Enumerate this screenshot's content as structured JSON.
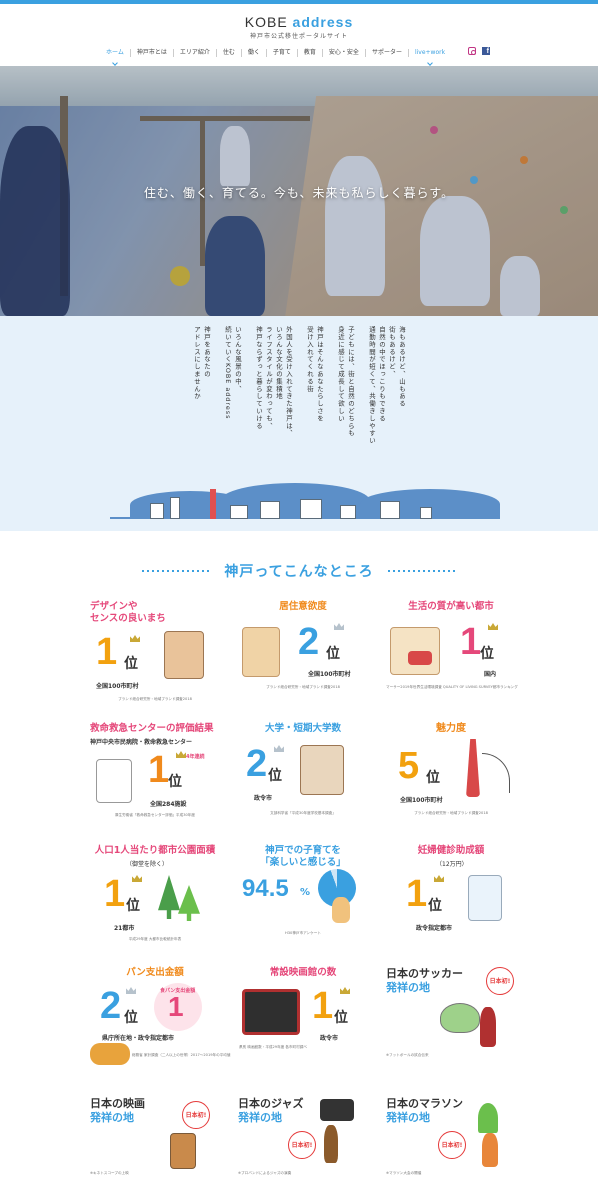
{
  "header": {
    "logo_main": "KOBE ",
    "logo_accent": "address",
    "logo_sub": "神戸市公式移住ポータルサイト"
  },
  "nav": [
    {
      "label": "ホーム"
    },
    {
      "label": "神戸市とは"
    },
    {
      "label": "エリア紹介"
    },
    {
      "label": "住む"
    },
    {
      "label": "働く"
    },
    {
      "label": "子育て"
    },
    {
      "label": "教育"
    },
    {
      "label": "安心・安全"
    },
    {
      "label": "サポーター"
    },
    {
      "label": "live+work"
    }
  ],
  "hero": {
    "catch": "住む、働く、育てる。今も、未来も私らしく暮らす。"
  },
  "intro": {
    "columns": [
      "海もあるけど、山もある",
      "街もあるけど、",
      "自然の中でほっこりもできる",
      "通勤時間が短くて、共働きしやすい",
      "",
      "子どもには、街と自然のどちらも",
      "身近に感じて成長して欲しい",
      "",
      "神戸はそんなあなたらしさを",
      "受け入れてくれる街",
      "",
      "外国人を受け入れてきた神戸は、",
      "いろんな文化の集積地",
      "ライフスタイルが変わっても、",
      "神戸ならずっと暮らしていける",
      "",
      "いろんな風景の中、",
      "続いていくKOBE address",
      "",
      "神戸をあなたの",
      "アドレスにしませんか"
    ]
  },
  "features": {
    "title": "神戸ってこんなところ",
    "cards": [
      {
        "title1": "デザインや",
        "title2": "センスの良いまち",
        "rank": "1",
        "unit": "位",
        "sub": "全国100市町村",
        "note": "ブランド総合研究所・地域ブランド調査2018"
      },
      {
        "title1": "居住意欲度",
        "title2": "",
        "rank": "2",
        "unit": "位",
        "sub": "全国100市町村",
        "note": "ブランド総合研究所・地域ブランド調査2018"
      },
      {
        "title1": "生活の質が高い都市",
        "title2": "",
        "rank": "1",
        "unit": "位",
        "sub": "国内",
        "note": "マーサー2019年世界生活環境調査 QUALITY OF LIVING SURVEY都市ランキング"
      },
      {
        "title1": "救命救急センターの評価結果",
        "title2": "神戸中央市民病院・救命救急センター",
        "rank": "1",
        "unit": "位",
        "sub": "全国284施設",
        "badge": "4年連続",
        "note": "厚生労働省「救命救急センター評価」平成30年度"
      },
      {
        "title1": "大学・短期大学数",
        "title2": "",
        "rank": "2",
        "unit": "位",
        "sub": "政令市",
        "note": "文部科学省「平成30年度学校基本調査」"
      },
      {
        "title1": "魅力度",
        "title2": "",
        "rank": "5",
        "unit": "位",
        "sub": "全国100市町村",
        "note": "ブランド総合研究所・地域ブランド調査2018"
      },
      {
        "title1": "人口1人当たり都市公園面積",
        "title2": "（御堂を除く）",
        "rank": "1",
        "unit": "位",
        "sub": "21都市",
        "note": "平成29年度 大都市比較統計年表"
      },
      {
        "title1": "神戸での子育てを",
        "title2": "「楽しいと感じる」",
        "rank": "94.5",
        "unit": "%",
        "sub": "",
        "note": "H30神戸市アンケート"
      },
      {
        "title1": "妊婦健診助成額",
        "title2": "（12万円）",
        "rank": "1",
        "unit": "位",
        "sub": "政令指定都市",
        "note": ""
      },
      {
        "title1": "パン支出金額",
        "title2": "食パン支出金額",
        "rank": "2",
        "rank2": "1",
        "unit": "位",
        "sub": "県庁所在地・政令指定都市",
        "note": "総務省 家計調査（二人以上の世帯）2017〜2019年の平均値"
      },
      {
        "title1": "常設映画館の数",
        "title2": "",
        "rank": "1",
        "unit": "位",
        "sub": "政令市",
        "note": "県別 映画館数・平成29年度 各市町村調べ"
      },
      {
        "title1": "日本のサッカー",
        "title2": "発祥の地",
        "rank": "",
        "unit": "",
        "sub": "",
        "badge": "日本初!",
        "note": "※フットボールの試合伝来"
      },
      {
        "title1": "日本の映画",
        "title2": "発祥の地",
        "rank": "",
        "unit": "",
        "sub": "",
        "badge": "日本初!",
        "note": "※キネトスコープの上映"
      },
      {
        "title1": "日本のジャズ",
        "title2": "発祥の地",
        "rank": "",
        "unit": "",
        "sub": "",
        "badge": "日本初!",
        "note": "※プロバンドによるジャズの演奏"
      },
      {
        "title1": "日本のマラソン",
        "title2": "発祥の地",
        "rank": "",
        "unit": "",
        "sub": "",
        "badge": "日本初!",
        "note": "※マラソン大会の開催"
      }
    ]
  },
  "colors": {
    "accent": "#3aa0e0",
    "pink": "#e5487a",
    "gold": "#f2a10f",
    "orange": "#f08a1c"
  },
  "icons": [
    "instagram-icon",
    "facebook-icon",
    "crown-icon",
    "chevron-down-icon"
  ]
}
